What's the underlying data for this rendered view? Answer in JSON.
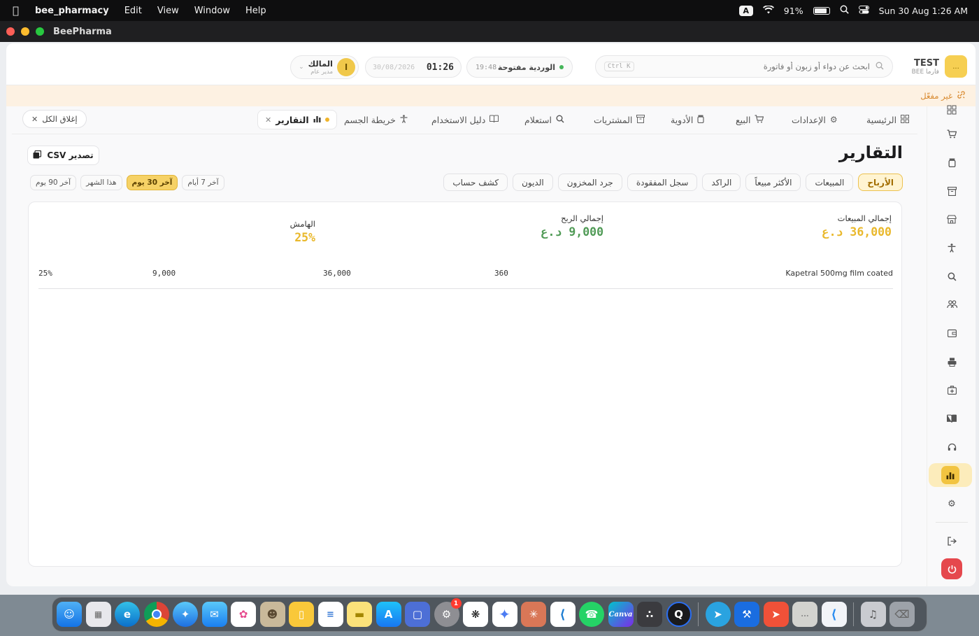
{
  "menubar": {
    "app_name": "bee_pharmacy",
    "items": [
      "Edit",
      "View",
      "Window",
      "Help"
    ],
    "input_source": "A",
    "battery_percent": "91%",
    "battery_level": 0.91,
    "datetime": "Sun 30 Aug  1:26 AM"
  },
  "window": {
    "title": "BeePharma"
  },
  "header": {
    "brand_name": "TEST",
    "brand_sub": "BEE فارما",
    "brand_logo_text": "...",
    "search_placeholder": "ابحث عن دواء أو زبون أو فاتورة",
    "search_shortcut": "Ctrl K",
    "shift_status": "الوردية مفتوحة",
    "shift_time": "19:48",
    "clock_date": "30/08/2026",
    "clock_time": "01:26",
    "user_name": "المالك",
    "user_role": "مدير عام",
    "user_initial": "ا"
  },
  "banner": {
    "text": "غير مفعّل"
  },
  "tabs": [
    {
      "label": "الرئيسية",
      "icon": "grid-icon"
    },
    {
      "label": "الإعدادات",
      "icon": "gear-icon"
    },
    {
      "label": "البيع",
      "icon": "cart-icon"
    },
    {
      "label": "الأدوية",
      "icon": "pill-bottle-icon"
    },
    {
      "label": "المشتريات",
      "icon": "archive-icon"
    },
    {
      "label": "استعلام",
      "icon": "search-icon"
    },
    {
      "label": "دليل الاستخدام",
      "icon": "book-icon"
    },
    {
      "label": "خريطة الجسم",
      "icon": "body-icon"
    }
  ],
  "active_tab": {
    "label": "التقارير",
    "icon": "chart-icon"
  },
  "close_all": "إغلاق الكل",
  "page": {
    "title": "التقارير",
    "export_label": "تصدير CSV",
    "report_types": [
      "الأرباح",
      "المبيعات",
      "الأكثر مبيعاً",
      "الراكد",
      "سجل المفقودة",
      "جرد المخزون",
      "الديون",
      "كشف حساب"
    ],
    "active_report": "الأرباح",
    "ranges": [
      "آخر 7 أيام",
      "آخر 30 يوم",
      "هذا الشهر",
      "آخر 90 يوم"
    ],
    "active_range": "آخر 30 يوم"
  },
  "summary": {
    "sales_label": "إجمالي المبيعات",
    "sales_value": "36,000 د.ع",
    "profit_label": "إجمالي الربح",
    "profit_value": "9,000 د.ع",
    "margin_label": "الهامش",
    "margin_value": "25%"
  },
  "table": {
    "rows": [
      {
        "name": "Kapetral 500mg film coated",
        "qty": "360",
        "sales": "36,000",
        "profit": "9,000",
        "margin": "25%"
      }
    ]
  },
  "colors": {
    "accent": "#f2c441",
    "sales_value": "#e9b82b",
    "profit_value": "#4f9a55",
    "margin_value": "#e9b82b",
    "banner_text": "#d8892e"
  },
  "dock": {
    "apps": [
      "finder-icon",
      "launchpad-icon",
      "edge-icon",
      "chrome-icon",
      "safari-icon",
      "mail-icon",
      "photos-icon",
      "contacts-icon",
      "notes-icon",
      "reminders-icon",
      "stickies-icon",
      "appstore-icon",
      "preview-icon",
      "settings-icon",
      "chatgpt-icon",
      "gemini-icon",
      "claude-icon",
      "vscode-icon",
      "whatsapp-icon",
      "canva-icon",
      "davinci-icon",
      "quicktime-icon",
      "telegram-icon",
      "xcode-icon",
      "rocket-icon",
      "beepharma-icon",
      "flutter-icon",
      "music-icon",
      "trash-icon"
    ],
    "settings_badge": "1",
    "canva_label": "Canva"
  }
}
